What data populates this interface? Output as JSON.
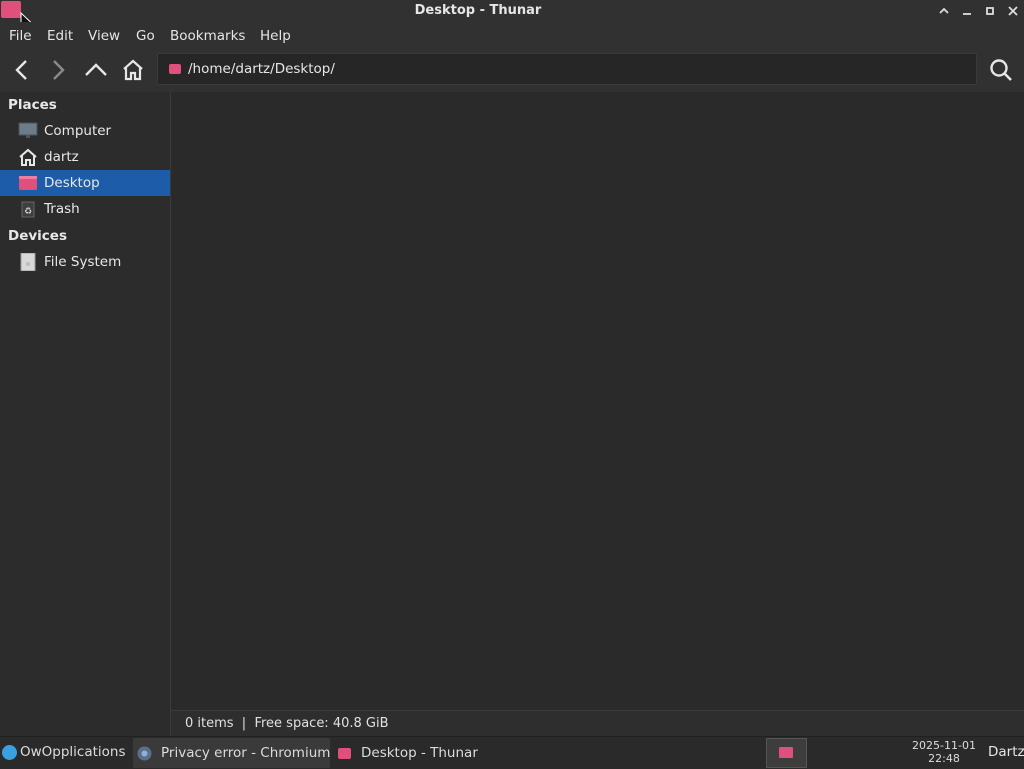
{
  "window": {
    "title": "Desktop - Thunar"
  },
  "menubar": {
    "items": [
      "File",
      "Edit",
      "View",
      "Go",
      "Bookmarks",
      "Help"
    ]
  },
  "toolbar": {
    "icons": [
      "back-icon",
      "forward-icon",
      "up-icon",
      "home-icon",
      "search-icon"
    ],
    "location": "/home/dartz/Desktop/"
  },
  "sidebar": {
    "places_label": "Places",
    "places": [
      {
        "label": "Computer",
        "icon": "computer-icon"
      },
      {
        "label": "dartz",
        "icon": "home-icon"
      },
      {
        "label": "Desktop",
        "icon": "folder-icon",
        "selected": true
      },
      {
        "label": "Trash",
        "icon": "trash-icon"
      }
    ],
    "devices_label": "Devices",
    "devices": [
      {
        "label": "File System",
        "icon": "drive-icon"
      }
    ]
  },
  "status": {
    "text": "0 items  |  Free space: 40.8 GiB"
  },
  "taskbar": {
    "start_label": "OwOpplications",
    "tasks": [
      "Privacy error - Chromium",
      "Desktop - Thunar"
    ],
    "clock_date": "2025-11-01",
    "clock_time": "22:48",
    "user": "Dartz"
  },
  "colors": {
    "accent": "#1c5ca8",
    "folder": "#e0507c",
    "background": "#2b2b2b"
  }
}
